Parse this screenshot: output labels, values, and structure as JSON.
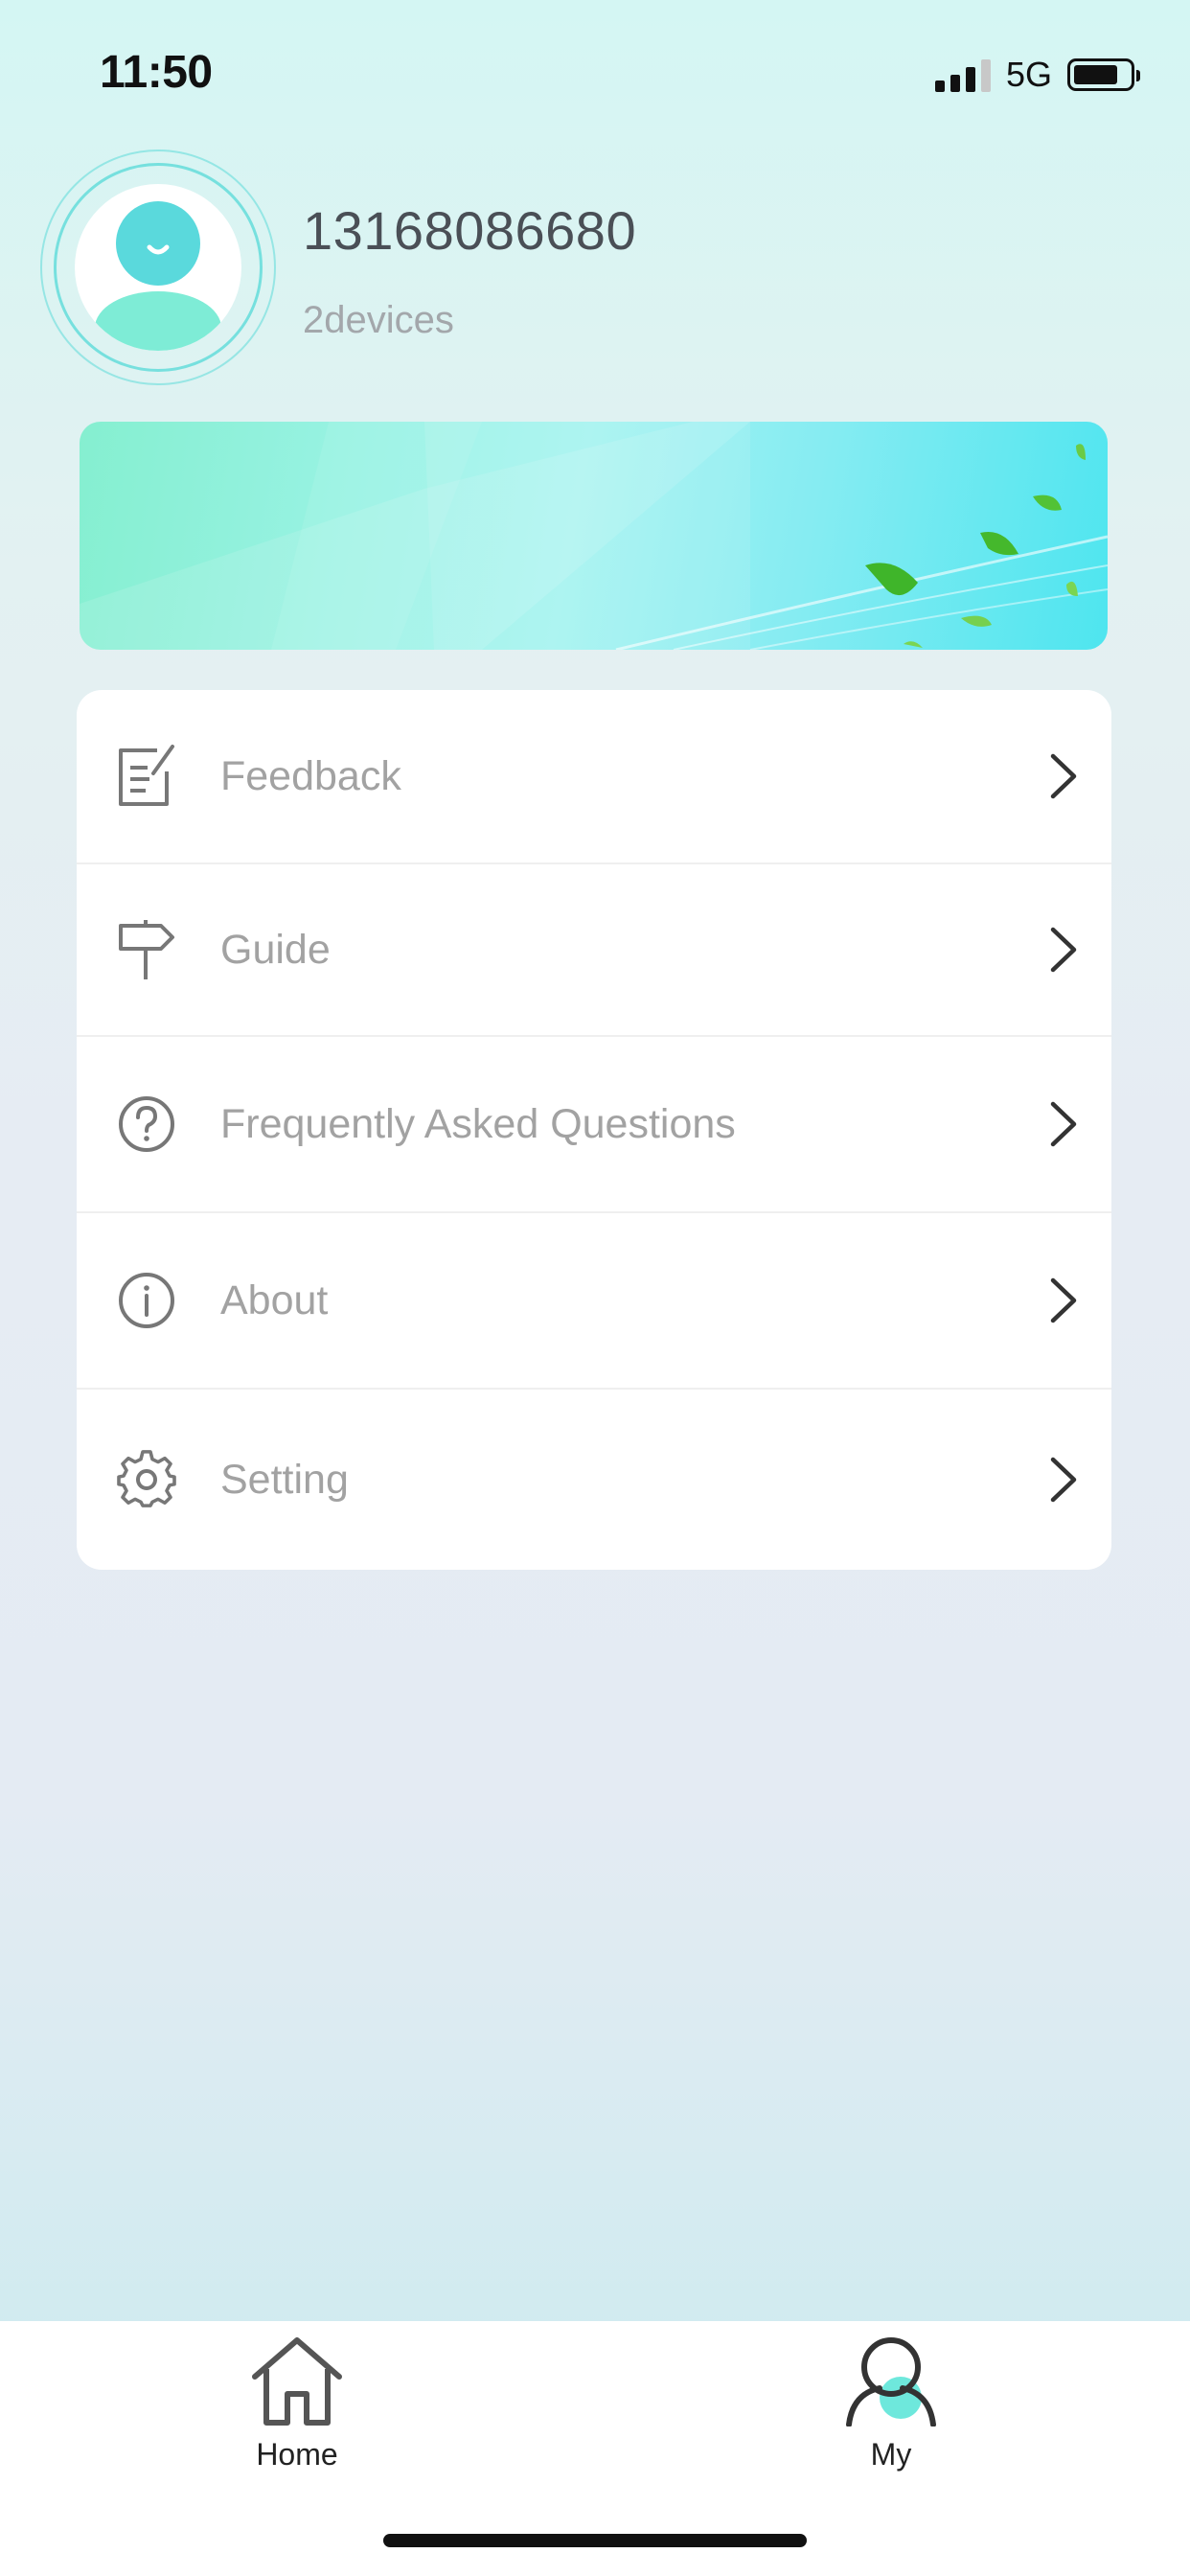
{
  "status_bar": {
    "time": "11:50",
    "network": "5G",
    "battery_level": 0.8
  },
  "profile": {
    "phone": "13168086680",
    "devices": "2devices",
    "avatar_icon": "user-avatar-icon"
  },
  "banner": {
    "image": "leaves-banner"
  },
  "menu": {
    "items": [
      {
        "label": "Feedback",
        "icon": "feedback-icon"
      },
      {
        "label": "Guide",
        "icon": "signpost-icon"
      },
      {
        "label": "Frequently Asked Questions",
        "icon": "question-icon"
      },
      {
        "label": "About",
        "icon": "info-icon"
      },
      {
        "label": "Setting",
        "icon": "gear-icon"
      }
    ]
  },
  "tabbar": {
    "tabs": [
      {
        "label": "Home",
        "icon": "home-icon",
        "active": false
      },
      {
        "label": "My",
        "icon": "person-icon",
        "active": true
      }
    ]
  },
  "colors": {
    "accent": "#5cdbd8",
    "label": "#a2a2a2",
    "phone": "#4a4f56"
  }
}
